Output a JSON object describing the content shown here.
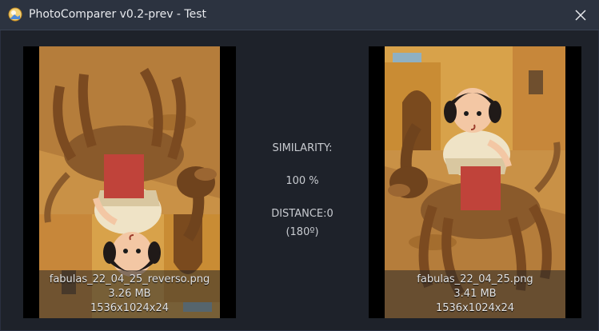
{
  "window": {
    "title": "PhotoComparer v0.2-prev - Test",
    "icons": {
      "app": "photo-comparer-app-icon",
      "close": "close-icon"
    }
  },
  "left_image": {
    "filename": "fabulas_22_04_25_reverso.png",
    "size": "3.26 MB",
    "dimensions": "1536x1024x24",
    "description": "girl riding brindle dog, flipped upside down"
  },
  "right_image": {
    "filename": "fabulas_22_04_25.png",
    "size": "3.41 MB",
    "dimensions": "1536x1024x24",
    "description": "girl riding brindle dog"
  },
  "comparison": {
    "similarity_label": "SIMILARITY:",
    "similarity_value": "100 %",
    "distance": "DISTANCE:0",
    "rotation": "(180º)"
  },
  "colors": {
    "titlebar": "#2c3340",
    "background": "#1e222a",
    "text": "#d6d8dc"
  }
}
